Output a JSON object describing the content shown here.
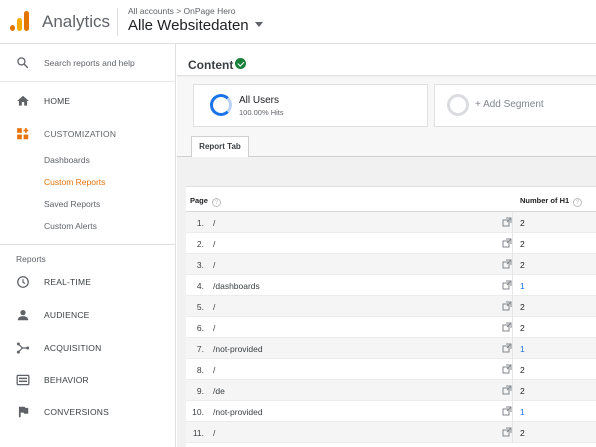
{
  "header": {
    "app_title": "Analytics",
    "breadcrumb": "All accounts > OnPage Hero",
    "view_name": "Alle Websitedaten",
    "brand_colors": {
      "orange": "#e37400",
      "yellow": "#f9ab00"
    }
  },
  "sidebar": {
    "search_placeholder": "Search reports and help",
    "home_label": "HOME",
    "customization_label": "CUSTOMIZATION",
    "customization_items": [
      {
        "label": "Dashboards",
        "active": false
      },
      {
        "label": "Custom Reports",
        "active": true
      },
      {
        "label": "Saved Reports",
        "active": false
      },
      {
        "label": "Custom Alerts",
        "active": false
      }
    ],
    "reports_header": "Reports",
    "report_items": [
      {
        "label": "REAL-TIME",
        "icon": "clock-icon"
      },
      {
        "label": "AUDIENCE",
        "icon": "person-icon"
      },
      {
        "label": "ACQUISITION",
        "icon": "acquisition-icon"
      },
      {
        "label": "BEHAVIOR",
        "icon": "behavior-icon"
      },
      {
        "label": "CONVERSIONS",
        "icon": "flag-icon"
      }
    ],
    "active_color": "#e8710a"
  },
  "content": {
    "title": "Content",
    "segment_name": "All Users",
    "segment_percent": "100.00% Hits",
    "add_segment": "+ Add Segment",
    "tab_label": "Report Tab"
  },
  "table": {
    "col_page": "Page",
    "col_metric": "Number of H1",
    "help_glyph": "?",
    "rows": [
      {
        "num": "1.",
        "page": "/",
        "value": "2"
      },
      {
        "num": "2.",
        "page": "/",
        "value": "2"
      },
      {
        "num": "3.",
        "page": "/",
        "value": "2"
      },
      {
        "num": "4.",
        "page": "/dashboards",
        "value": "1"
      },
      {
        "num": "5.",
        "page": "/",
        "value": "2"
      },
      {
        "num": "6.",
        "page": "/",
        "value": "2"
      },
      {
        "num": "7.",
        "page": "/not-provided",
        "value": "1"
      },
      {
        "num": "8.",
        "page": "/",
        "value": "2"
      },
      {
        "num": "9.",
        "page": "/de",
        "value": "2"
      },
      {
        "num": "10.",
        "page": "/not-provided",
        "value": "1"
      },
      {
        "num": "11.",
        "page": "/",
        "value": "2"
      }
    ]
  }
}
